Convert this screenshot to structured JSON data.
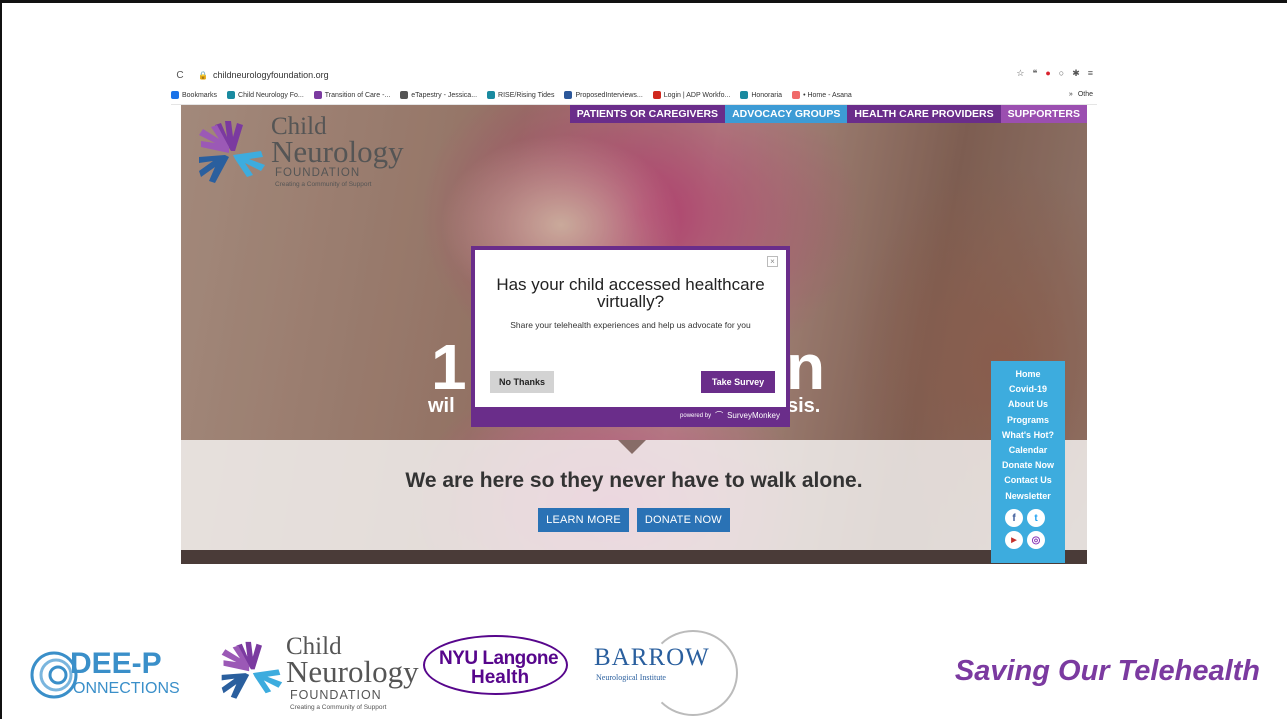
{
  "browser": {
    "url": "childneurologyfoundation.org",
    "bookmarks": [
      {
        "label": "Bookmarks",
        "color": "#1a73e8"
      },
      {
        "label": "Child Neurology Fo...",
        "color": "#1a8aa0"
      },
      {
        "label": "Transition of Care -...",
        "color": "#7b3aa0"
      },
      {
        "label": "eTapestry - Jessica...",
        "color": "#555555"
      },
      {
        "label": "RISE/Rising Tides",
        "color": "#1a8aa0"
      },
      {
        "label": "ProposedInterviews...",
        "color": "#2b579a"
      },
      {
        "label": "Login | ADP Workfo...",
        "color": "#d0271d"
      },
      {
        "label": "Honoraria",
        "color": "#1a8aa0"
      },
      {
        "label": "• Home - Asana",
        "color": "#f06a6a"
      }
    ],
    "bookmarks_overflow": "»",
    "other_bookmarks": "Othe"
  },
  "site": {
    "top_nav": [
      "PATIENTS OR CAREGIVERS",
      "ADVOCACY GROUPS",
      "HEALTH CARE PROVIDERS",
      "SUPPORTERS"
    ],
    "logo": {
      "line1": "Child",
      "line2": "Neurology",
      "line3": "FOUNDATION",
      "tagline": "Creating a Community of Support"
    },
    "hero_fragments": {
      "big_left": "1",
      "big_right": "n",
      "small_left": "wil",
      "small_right": "sis."
    },
    "band_text": "We are here so they never have to walk alone.",
    "band_buttons": [
      "LEARN MORE",
      "DONATE NOW"
    ],
    "side_menu": [
      "Home",
      "Covid-19",
      "About Us",
      "Programs",
      "What's Hot?",
      "Calendar",
      "Donate Now",
      "Contact Us",
      "Newsletter"
    ]
  },
  "modal": {
    "title": "Has your child accessed healthcare virtually?",
    "subtitle": "Share your telehealth experiences and help us advocate for you",
    "close_label": "×",
    "no_button": "No Thanks",
    "take_button": "Take Survey",
    "powered_by": "powered by",
    "brand": "SurveyMonkey"
  },
  "footer": {
    "deep_line1": "DEE-P",
    "deep_line2": "ONNECTIONS",
    "cnf_line1": "Child",
    "cnf_line2": "Neurology",
    "cnf_line3": "FOUNDATION",
    "cnf_tagline": "Creating a Community of Support",
    "nyu_line1": "NYU Langone",
    "nyu_line2": "Health",
    "barrow_name": "BARROW",
    "barrow_sub": "Neurological Institute",
    "tagline": "Saving Our Telehealth"
  },
  "colors": {
    "purple": "#6a2d8a",
    "blue": "#3d9bd5",
    "tagline": "#7b3aa0"
  }
}
